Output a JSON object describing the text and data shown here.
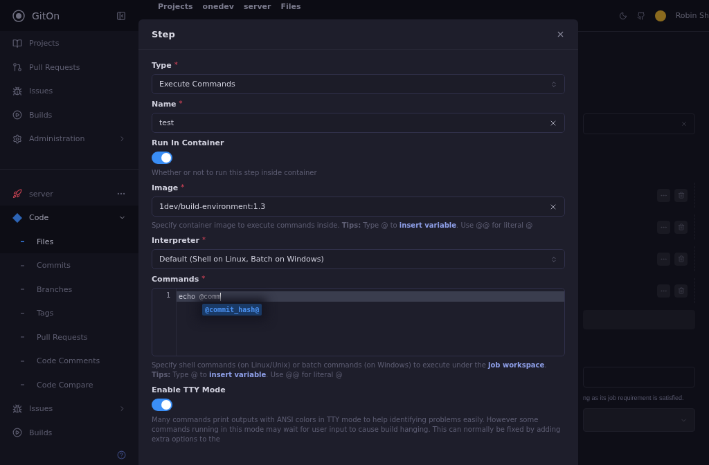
{
  "sidebar": {
    "brand": "GitOn",
    "nav": [
      {
        "label": "Projects",
        "kind": "book",
        "chevron": false
      },
      {
        "label": "Pull Requests",
        "kind": "pull",
        "chevron": false
      },
      {
        "label": "Issues",
        "kind": "bug",
        "chevron": false
      },
      {
        "label": "Builds",
        "kind": "play",
        "chevron": false
      },
      {
        "label": "Administration",
        "kind": "gear",
        "chevron": true
      }
    ],
    "project": {
      "name": "server"
    },
    "project_nav": [
      {
        "label": "Code",
        "kind": "git",
        "chevron": true,
        "expanded": true,
        "children": [
          {
            "label": "Files",
            "selected": true
          },
          {
            "label": "Commits",
            "selected": false
          },
          {
            "label": "Branches",
            "selected": false
          },
          {
            "label": "Tags",
            "selected": false
          },
          {
            "label": "Pull Requests",
            "selected": false
          },
          {
            "label": "Code Comments",
            "selected": false
          },
          {
            "label": "Code Compare",
            "selected": false
          }
        ]
      },
      {
        "label": "Issues",
        "kind": "bug",
        "chevron": true,
        "expanded": false
      },
      {
        "label": "Builds",
        "kind": "play",
        "chevron": false,
        "expanded": false
      }
    ]
  },
  "topbar": {
    "breadcrumb": [
      "Projects",
      "onedev",
      "server",
      "Files"
    ],
    "user": "Robin Sh"
  },
  "background": {
    "note": "ng as its job requirement is satisfied."
  },
  "dialog": {
    "title": "Step",
    "fields": [
      {
        "kind": "select",
        "label": "Type",
        "required_mark": "*",
        "value": "Execute Commands"
      },
      {
        "kind": "input",
        "label": "Name",
        "required_mark": "*",
        "value": "test"
      },
      {
        "kind": "toggle",
        "label": "Run In Container",
        "on": true,
        "help": [
          {
            "kind": "text",
            "text": "Whether or not to run this step inside container"
          }
        ]
      },
      {
        "kind": "input",
        "label": "Image",
        "required_mark": "*",
        "value": "1dev/build-environment:1.3",
        "help": [
          {
            "kind": "text",
            "text": "Specify container image to execute commands inside. "
          },
          {
            "kind": "bold",
            "text": "Tips:"
          },
          {
            "kind": "text",
            "text": " Type @ to "
          },
          {
            "kind": "link",
            "text": "insert variable"
          },
          {
            "kind": "text",
            "text": ". Use @@ for literal @"
          }
        ]
      },
      {
        "kind": "select",
        "label": "Interpreter",
        "required_mark": "*",
        "value": "Default (Shell on Linux, Batch on Windows)"
      },
      {
        "kind": "code",
        "label": "Commands",
        "required_mark": "*",
        "lines": [
          {
            "number": "1",
            "text": "echo @comm"
          }
        ],
        "suggestion": "@commit_hash@",
        "help": [
          {
            "kind": "text",
            "text": "Specify shell commands (on Linux/Unix) or batch commands (on Windows) to execute under the "
          },
          {
            "kind": "link",
            "text": "job workspace"
          },
          {
            "kind": "text",
            "text": ". "
          },
          {
            "kind": "bold",
            "text": "Tips:"
          },
          {
            "kind": "text",
            "text": " Type @ to "
          },
          {
            "kind": "link",
            "text": "insert variable"
          },
          {
            "kind": "text",
            "text": ". Use @@ for literal @"
          }
        ]
      },
      {
        "kind": "toggle",
        "label": "Enable TTY Mode",
        "on": true,
        "help": [
          {
            "kind": "text",
            "text": "Many commands print outputs with ANSI colors in TTY mode to help identifying problems easily. However some commands running in this mode may wait for user input to cause build hanging. This can normally be fixed by adding extra options to the"
          }
        ]
      }
    ]
  }
}
